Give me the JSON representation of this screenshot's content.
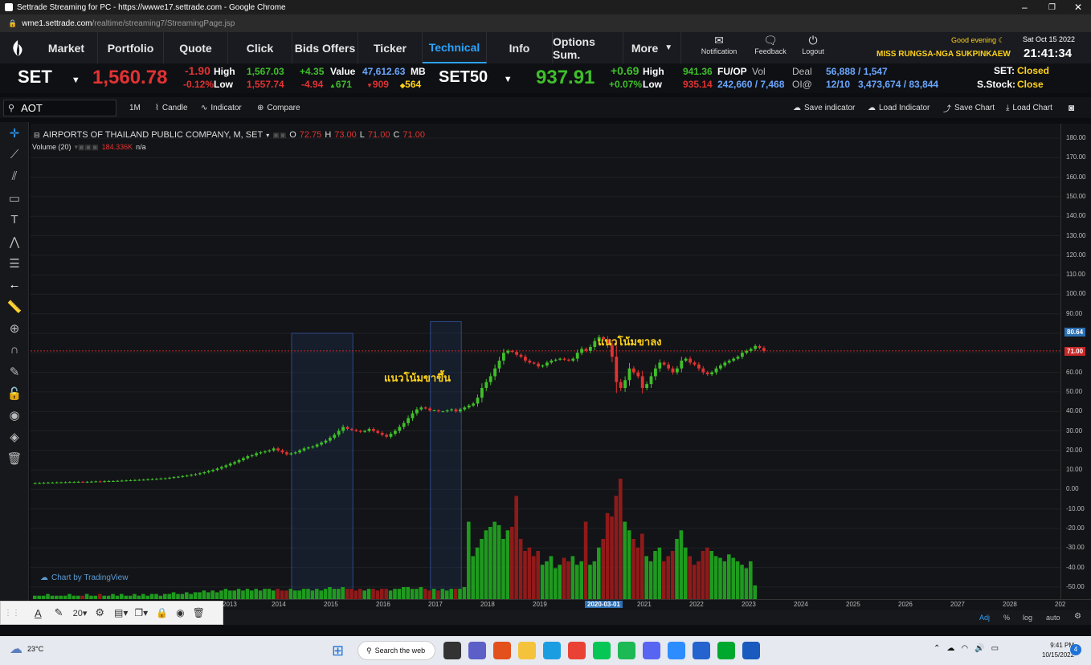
{
  "browser": {
    "title": "Settrade Streaming for PC - https://wwwe17.settrade.com - Google Chrome",
    "url_host": "wme1.settrade.com",
    "url_path": "/realtime/streaming7/StreamingPage.jsp"
  },
  "nav": {
    "items": [
      "Market",
      "Portfolio",
      "Quote",
      "Click",
      "Bids Offers",
      "Ticker",
      "Technical",
      "Info",
      "Options Sum.",
      "More"
    ],
    "active": "Technical",
    "notification": "Notification",
    "feedback": "Feedback",
    "logout": "Logout",
    "greeting": "Good evening",
    "user": "MISS RUNGSA-NGA SUKPINKAEW",
    "date": "Sat Oct 15 2022",
    "time": "21:41:34"
  },
  "ticker": {
    "set_label": "SET",
    "set_value": "1,560.78",
    "set_change": "-1.90",
    "set_change_pct": "-0.12%",
    "high_label": "High",
    "low_label": "Low",
    "set_high": "1,567.03",
    "set_low": "1,557.74",
    "up_pts": "+4.35",
    "down_pts": "-4.94",
    "value_label": "Value",
    "value": "47,612.63",
    "value_unit": "MB",
    "adv": "671",
    "dec": "909",
    "unch": "564",
    "set50_label": "SET50",
    "set50_value": "937.91",
    "set50_change": "+0.69",
    "set50_change_pct": "+0.07%",
    "set50_high": "941.36",
    "set50_low": "935.14",
    "fuop": "FU/OP",
    "vol_label": "Vol",
    "deal_label": "Deal",
    "oi_label": "OI@",
    "vol": "242,660 / 7,468",
    "deal": "56,888 / 1,547",
    "oi_date": "12/10",
    "oi": "3,473,674 / 83,844",
    "set_status_label": "SET:",
    "set_status": "Closed",
    "sstock_label": "S.Stock:",
    "sstock_status": "Close"
  },
  "toolbar": {
    "symbol": "AOT",
    "interval": "1M",
    "candle": "Candle",
    "indicator": "Indicator",
    "compare": "Compare",
    "save_indicator": "Save indicator",
    "load_indicator": "Load Indicator",
    "save_chart": "Save Chart",
    "load_chart": "Load Chart"
  },
  "legend": {
    "name": "AIRPORTS OF THAILAND PUBLIC COMPANY, M, SET",
    "o_label": "O",
    "o": "72.75",
    "h_label": "H",
    "h": "73.00",
    "l_label": "L",
    "l": "71.00",
    "c_label": "C",
    "c": "71.00",
    "volume_label": "Volume (20)",
    "volume_value": "184.336K",
    "volume_na": "n/a"
  },
  "annotations": {
    "uptrend": "แนวโน้มขาขึ้น",
    "downtrend": "แนวโน้มขาลง"
  },
  "watermark": "Chart by TradingView",
  "price_tags": {
    "last": "71.00",
    "max": "80.64"
  },
  "y_axis": [
    "180.00",
    "170.00",
    "160.00",
    "150.00",
    "140.00",
    "130.00",
    "120.00",
    "110.00",
    "100.00",
    "90.00",
    "80.00",
    "70.00",
    "60.00",
    "50.00",
    "40.00",
    "30.00",
    "20.00",
    "10.00",
    "0.00",
    "-10.00",
    "-20.00",
    "-30.00",
    "-40.00",
    "-50.00"
  ],
  "x_axis": [
    "2013",
    "2014",
    "2015",
    "2016",
    "2017",
    "2018",
    "2019",
    "2020-03-01",
    "2021",
    "2022",
    "2023",
    "2024",
    "2025",
    "2026",
    "2027",
    "2028",
    "202"
  ],
  "bottom_controls": [
    "Adj",
    "%",
    "log",
    "auto"
  ],
  "drawtools": {
    "size": "20"
  },
  "chart_data": {
    "type": "candlestick",
    "symbol": "AOT",
    "interval": "1M",
    "x_start": "2012-01",
    "close": [
      3.2,
      3.3,
      3.4,
      3.5,
      3.5,
      3.6,
      3.6,
      3.7,
      3.8,
      3.8,
      3.9,
      3.8,
      3.9,
      4.0,
      4.1,
      4.0,
      4.2,
      4.3,
      4.3,
      4.4,
      4.5,
      4.6,
      4.7,
      4.8,
      4.9,
      5.0,
      5.2,
      5.3,
      5.4,
      5.6,
      5.7,
      6.0,
      6.3,
      6.5,
      6.8,
      7.1,
      7.5,
      7.8,
      8.3,
      8.8,
      9.4,
      10.0,
      10.7,
      11.5,
      12.3,
      13.2,
      14.0,
      15.0,
      16.0,
      17.0,
      17.5,
      18.5,
      19.0,
      19.5,
      20.0,
      21.0,
      20.0,
      19.0,
      18.0,
      18.5,
      19.0,
      20.0,
      21.0,
      21.5,
      22.0,
      23.0,
      24.0,
      25.0,
      26.5,
      28.0,
      30.0,
      32.0,
      31.0,
      30.5,
      30.0,
      29.5,
      30.0,
      31.0,
      30.0,
      29.0,
      28.0,
      27.0,
      28.5,
      30.0,
      32.0,
      34.0,
      36.5,
      39.0,
      41.0,
      42.0,
      41.5,
      40.5,
      40.5,
      40.0,
      40.0,
      40.5,
      41.0,
      40.0,
      41.0,
      42.0,
      43.0,
      44.0,
      47.0,
      52.0,
      55.0,
      58.0,
      62.0,
      66.0,
      70.0,
      71.0,
      70.5,
      69.0,
      68.0,
      66.0,
      65.0,
      64.5,
      63.0,
      63.5,
      65.0,
      66.0,
      66.5,
      67.0,
      66.5,
      66.0,
      67.0,
      70.0,
      72.0,
      71.0,
      73.0,
      76.0,
      78.0,
      77.0,
      74.0,
      68.0,
      55.0,
      52.0,
      56.0,
      62.0,
      60.0,
      58.0,
      52.0,
      54.0,
      58.0,
      62.0,
      65.0,
      64.0,
      62.0,
      60.0,
      62.0,
      66.0,
      67.0,
      65.0,
      64.0,
      62.0,
      60.0,
      59.0,
      60.0,
      62.0,
      63.5,
      65.0,
      66.0,
      67.0,
      68.0,
      70.0,
      71.0,
      72.0,
      73.5,
      72.5,
      71.0
    ],
    "volume": [
      2,
      2,
      2,
      3,
      2,
      2,
      2,
      2,
      3,
      2,
      2,
      2,
      3,
      2,
      2,
      3,
      2,
      2,
      3,
      2,
      3,
      2,
      2,
      3,
      2,
      3,
      2,
      3,
      3,
      2,
      3,
      3,
      4,
      3,
      3,
      4,
      3,
      4,
      4,
      5,
      4,
      5,
      4,
      5,
      6,
      5,
      5,
      6,
      5,
      6,
      5,
      6,
      5,
      6,
      6,
      5,
      6,
      5,
      5,
      6,
      5,
      5,
      6,
      6,
      5,
      6,
      5,
      6,
      7,
      6,
      6,
      7,
      6,
      6,
      5,
      6,
      5,
      6,
      6,
      5,
      6,
      6,
      5,
      6,
      6,
      7,
      7,
      6,
      6,
      7,
      6,
      5,
      6,
      5,
      6,
      5,
      6,
      6,
      6,
      7,
      45,
      25,
      30,
      35,
      40,
      42,
      45,
      43,
      35,
      40,
      42,
      60,
      35,
      28,
      30,
      25,
      28,
      20,
      22,
      25,
      18,
      20,
      24,
      22,
      25,
      20,
      22,
      45,
      20,
      22,
      30,
      35,
      50,
      48,
      60,
      70,
      45,
      40,
      35,
      30,
      38,
      25,
      22,
      28,
      30,
      22,
      25,
      28,
      35,
      40,
      30,
      25,
      20,
      22,
      28,
      30,
      28,
      25,
      24,
      22,
      26,
      24,
      22,
      20,
      18,
      22,
      8
    ],
    "uptrend_range": [
      "2017-01",
      "2018-02"
    ],
    "downtrend_range": [
      "2019-09",
      "2020-03"
    ],
    "ylim": [
      -55,
      185
    ]
  }
}
